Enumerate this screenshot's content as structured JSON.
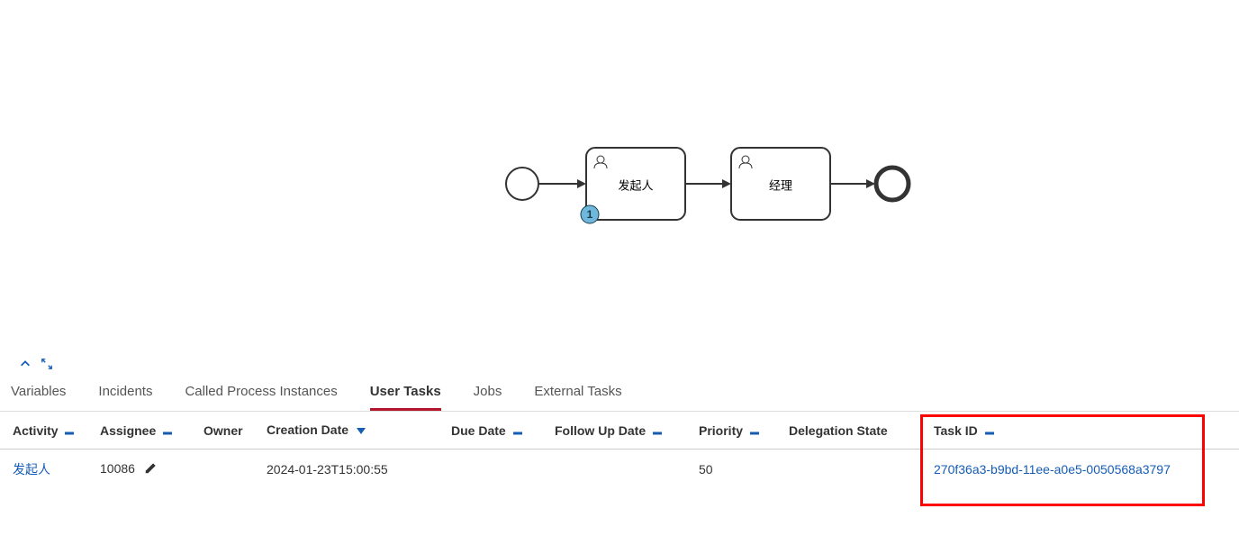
{
  "diagram": {
    "task1_label": "发起人",
    "task2_label": "经理",
    "badge_count": "1"
  },
  "tabs": [
    {
      "label": "Variables"
    },
    {
      "label": "Incidents"
    },
    {
      "label": "Called Process Instances"
    },
    {
      "label": "User Tasks"
    },
    {
      "label": "Jobs"
    },
    {
      "label": "External Tasks"
    }
  ],
  "table": {
    "headers": {
      "activity": "Activity",
      "assignee": "Assignee",
      "owner": "Owner",
      "creation_date": "Creation Date",
      "due_date": "Due Date",
      "follow_up_date": "Follow Up Date",
      "priority": "Priority",
      "delegation_state": "Delegation State",
      "task_id": "Task ID"
    },
    "rows": [
      {
        "activity": "发起人",
        "assignee": "10086",
        "owner": "",
        "creation_date": "2024-01-23T15:00:55",
        "due_date": "",
        "follow_up_date": "",
        "priority": "50",
        "delegation_state": "",
        "task_id": "270f36a3-b9bd-11ee-a0e5-0050568a3797"
      }
    ]
  }
}
